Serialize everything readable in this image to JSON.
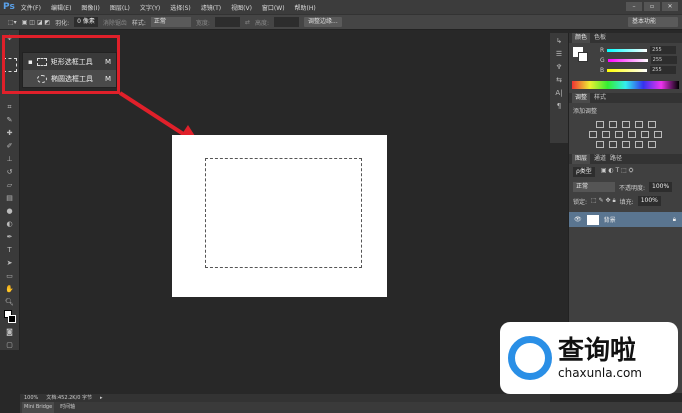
{
  "app": {
    "logo": "Ps"
  },
  "menu": [
    "文件(F)",
    "编辑(E)",
    "图像(I)",
    "图层(L)",
    "文字(Y)",
    "选择(S)",
    "滤镜(T)",
    "视图(V)",
    "窗口(W)",
    "帮助(H)"
  ],
  "window_controls": {
    "minimize": "–",
    "restore": "▫",
    "close": "✕"
  },
  "options": {
    "feather_label": "羽化:",
    "feather_value": "0 像素",
    "antialias": "消除锯齿",
    "style_label": "样式:",
    "style_value": "正常",
    "width_label": "宽度:",
    "height_label": "高度:",
    "refine_edge": "调整边缘...",
    "workspace": "基本功能"
  },
  "flyout": {
    "items": [
      {
        "label": "矩形选框工具",
        "key": "M"
      },
      {
        "label": "椭圆选框工具",
        "key": "M"
      }
    ]
  },
  "color_panel": {
    "tabs": [
      "颜色",
      "色板"
    ],
    "r_label": "R",
    "r": "255",
    "g_label": "G",
    "g": "255",
    "b_label": "B",
    "b": "255"
  },
  "adjust_panel": {
    "tabs": [
      "调整",
      "样式"
    ],
    "title": "添加调整"
  },
  "layers_panel": {
    "tabs": [
      "图层",
      "通道",
      "路径"
    ],
    "filter": "ρ类型",
    "blend": "正常",
    "opacity_label": "不透明度:",
    "opacity": "100%",
    "lock_label": "锁定:",
    "fill_label": "填充:",
    "fill": "100%",
    "layer_name": "背景"
  },
  "status": {
    "zoom": "100%",
    "doc": "文档:452.2K/0 字节"
  },
  "bottom_tabs": [
    "Mini Bridge",
    "时间轴"
  ],
  "watermark": {
    "name": "查询啦",
    "url": "chaxunla.com"
  }
}
